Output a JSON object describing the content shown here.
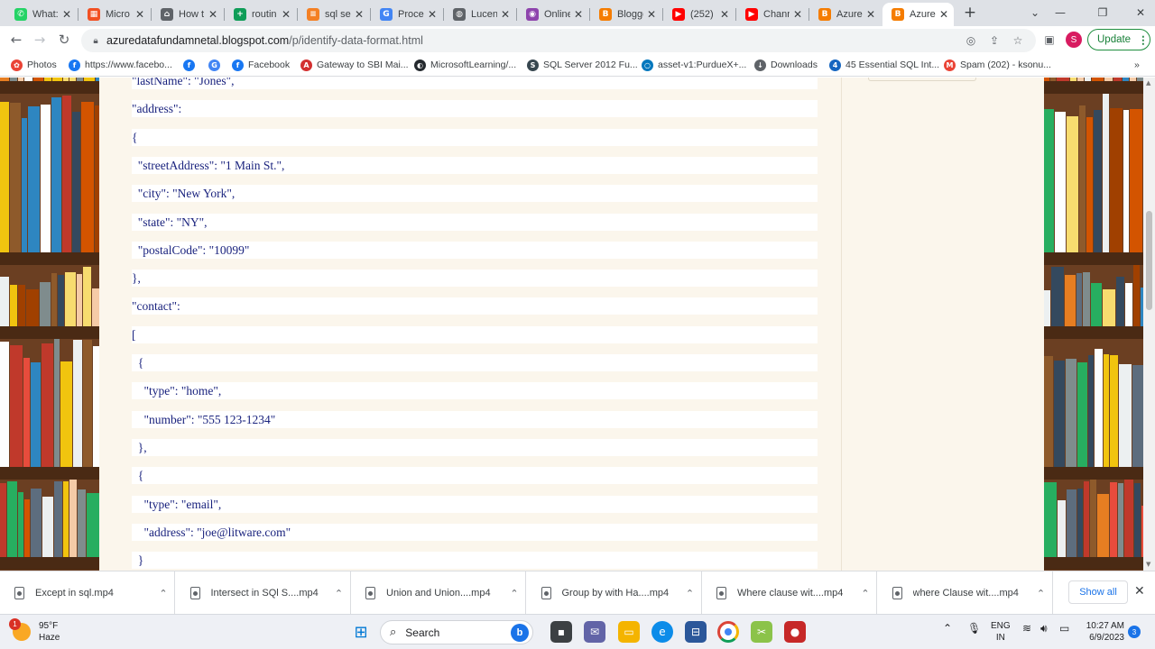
{
  "browser": {
    "tabs": [
      {
        "label": "What:",
        "icon": "whatsapp-icon",
        "color": "#25d366",
        "glyph": "✆"
      },
      {
        "label": "Micro",
        "icon": "microsoft-icon",
        "color": "#f25022",
        "glyph": "▦"
      },
      {
        "label": "How t",
        "icon": "home-icon",
        "color": "#5f6368",
        "glyph": "⌂"
      },
      {
        "label": "routin",
        "icon": "sheets-icon",
        "color": "#0f9d58",
        "glyph": "+"
      },
      {
        "label": "sql se",
        "icon": "stackoverflow-icon",
        "color": "#f48024",
        "glyph": "≡"
      },
      {
        "label": "Proce",
        "icon": "google-icon",
        "color": "#4285f4",
        "glyph": "G"
      },
      {
        "label": "Lucen",
        "icon": "globe-icon",
        "color": "#5f6368",
        "glyph": "◍"
      },
      {
        "label": "Online",
        "icon": "online-icon",
        "color": "#8e44ad",
        "glyph": "◉"
      },
      {
        "label": "Blogge",
        "icon": "blogger-icon",
        "color": "#f57c00",
        "glyph": "B"
      },
      {
        "label": "(252) ",
        "icon": "youtube-icon",
        "color": "#ff0000",
        "glyph": "▶"
      },
      {
        "label": "Chann",
        "icon": "youtube-icon",
        "color": "#ff0000",
        "glyph": "▶"
      },
      {
        "label": "Azure",
        "icon": "blogger-icon",
        "color": "#f57c00",
        "glyph": "B"
      },
      {
        "label": "Azure",
        "icon": "blogger-icon",
        "color": "#f57c00",
        "glyph": "B",
        "active": true
      }
    ],
    "url_host": "azuredatafundamnetal.blogspot.com",
    "url_path": "/p/identify-data-format.html",
    "profile_initial": "S",
    "update_label": "Update",
    "bookmarks": [
      {
        "label": "Photos",
        "icon": "photos-icon",
        "color": "#ea4335",
        "glyph": "✿"
      },
      {
        "label": "https://www.facebo...",
        "icon": "facebook-icon",
        "color": "#1877f2",
        "glyph": "f"
      },
      {
        "label": "",
        "icon": "facebook-icon",
        "color": "#1877f2",
        "glyph": "f"
      },
      {
        "label": "",
        "icon": "google-icon",
        "color": "#4285f4",
        "glyph": "G"
      },
      {
        "label": "Facebook",
        "icon": "facebook-icon",
        "color": "#1877f2",
        "glyph": "f"
      },
      {
        "label": "Gateway to SBI Mai...",
        "icon": "sbi-icon",
        "color": "#d32f2f",
        "glyph": "A"
      },
      {
        "label": "MicrosoftLearning/...",
        "icon": "github-icon",
        "color": "#24292e",
        "glyph": "◐"
      },
      {
        "label": "SQL Server 2012 Fu...",
        "icon": "sqlserver-icon",
        "color": "#37474f",
        "glyph": "S"
      },
      {
        "label": "asset-v1:PurdueX+...",
        "icon": "circle-icon",
        "color": "#0277bd",
        "glyph": "○"
      },
      {
        "label": "Downloads",
        "icon": "download-icon",
        "color": "#5f6368",
        "glyph": "↓"
      },
      {
        "label": "45 Essential SQL Int...",
        "icon": "bookmark-site-icon",
        "color": "#1565c0",
        "glyph": "4"
      },
      {
        "label": "Spam (202) - ksonu...",
        "icon": "gmail-icon",
        "color": "#ea4335",
        "glyph": "M"
      }
    ]
  },
  "post": {
    "lines": [
      "\"lastName\": \"Jones\",",
      "\"address\":",
      "{",
      "  \"streetAddress\": \"1 Main St.\",",
      "  \"city\": \"New York\",",
      "  \"state\": \"NY\",",
      "  \"postalCode\": \"10099\"",
      "},",
      "\"contact\":",
      "[",
      "  {",
      "    \"type\": \"home\",",
      "    \"number\": \"555 123-1234\"",
      "  },",
      "  {",
      "    \"type\": \"email\",",
      "    \"address\": \"joe@litware.com\"",
      "  }"
    ]
  },
  "downloads": {
    "items": [
      "Except in sql.mp4",
      "Intersect in SQl S....mp4",
      "Union and Union....mp4",
      "Group by with Ha....mp4",
      "Where clause wit....mp4",
      "where Clause wit....mp4"
    ],
    "show_all": "Show all"
  },
  "taskbar": {
    "weather_temp": "95°F",
    "weather_desc": "Haze",
    "weather_badge": "1",
    "search_label": "Search",
    "lang_line1": "ENG",
    "lang_line2": "IN",
    "time": "10:27 AM",
    "date": "6/9/2023",
    "notifications": "3"
  }
}
